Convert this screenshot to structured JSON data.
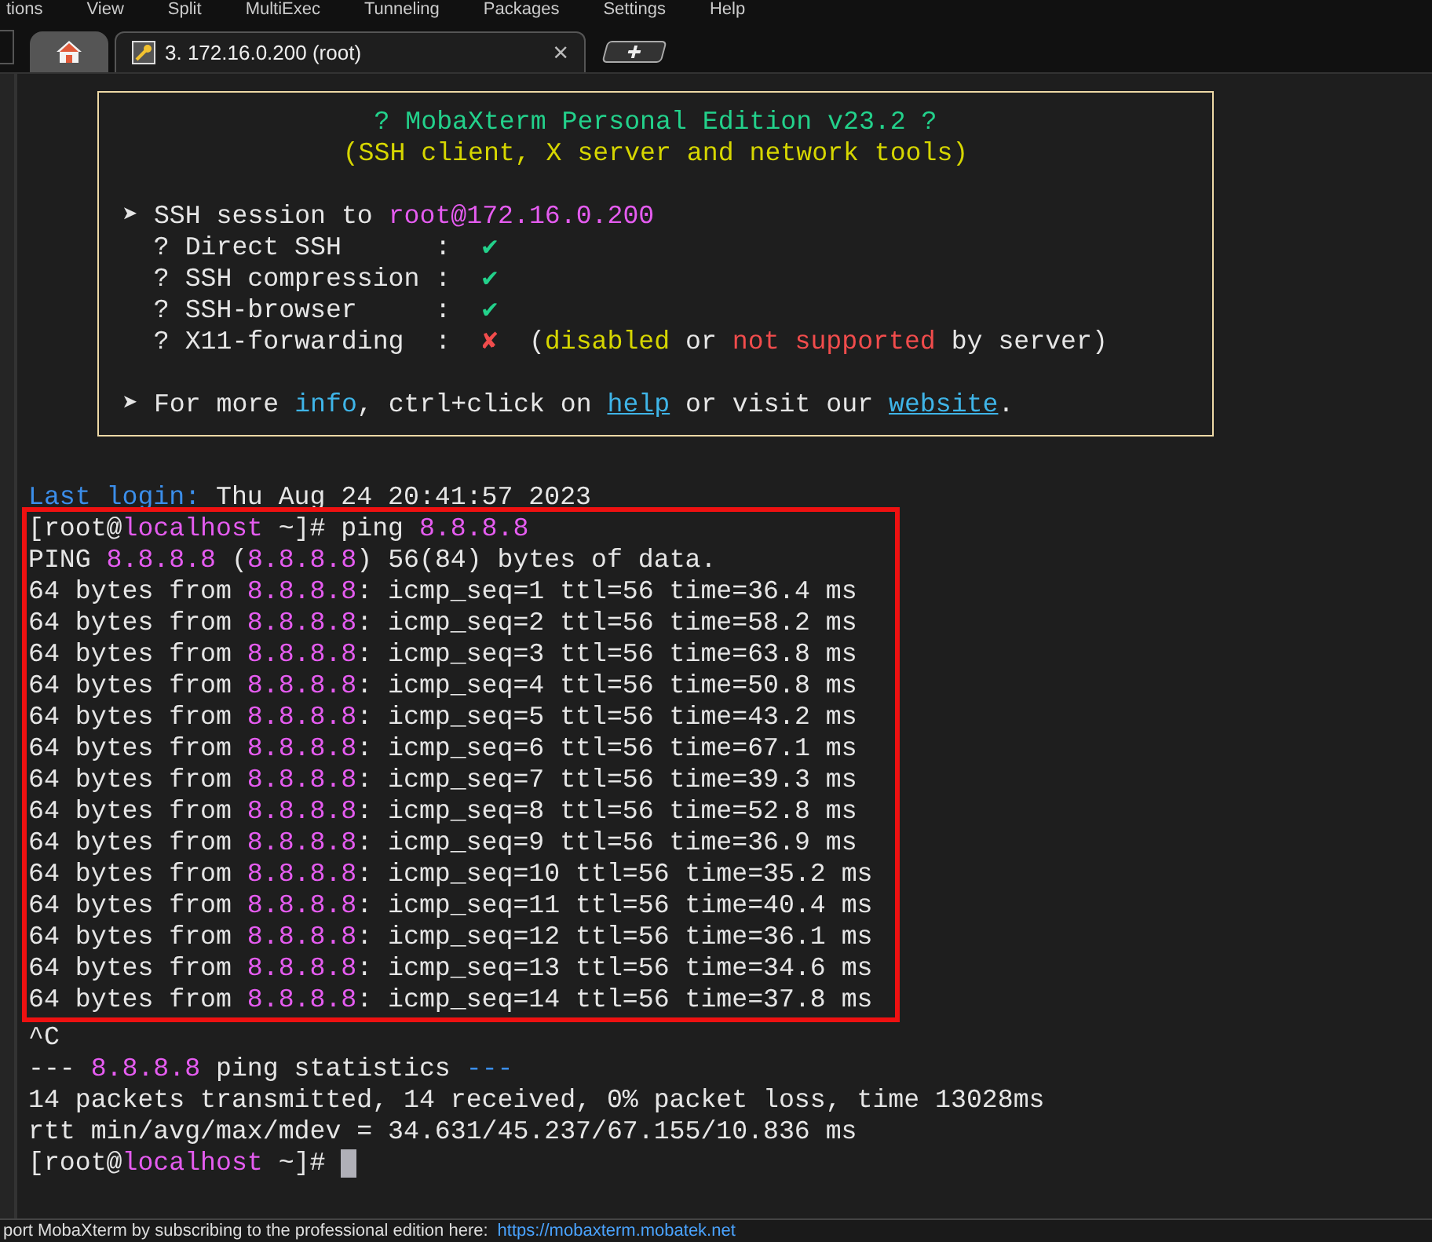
{
  "menu_bar": {
    "items": [
      "tions",
      "View",
      "Split",
      "MultiExec",
      "Tunneling",
      "Packages",
      "Settings",
      "Help"
    ]
  },
  "tabs": [
    {
      "kind": "home",
      "selected": false
    },
    {
      "kind": "session",
      "label": "3. 172.16.0.200 (root)",
      "selected": true,
      "close": "×"
    },
    {
      "kind": "new",
      "selected": false
    }
  ],
  "banner": {
    "header": [
      {
        "segments": [
          {
            "kind": "green",
            "text": "? MobaXterm Personal Edition v23.2 ?"
          }
        ]
      },
      {
        "segments": [
          {
            "kind": "yellow",
            "text": "(SSH client, X server and network tools)"
          }
        ]
      }
    ],
    "session": [
      {
        "segments": [
          {
            "kind": "plain",
            "text": "➤ SSH session to "
          },
          {
            "kind": "magenta",
            "text": "root@172.16.0.200"
          }
        ]
      },
      {
        "segments": [
          {
            "kind": "plain",
            "text": "  ? Direct SSH      :  "
          },
          {
            "kind": "green",
            "text": "✔"
          }
        ]
      },
      {
        "segments": [
          {
            "kind": "plain",
            "text": "  ? SSH compression :  "
          },
          {
            "kind": "green",
            "text": "✔"
          }
        ]
      },
      {
        "segments": [
          {
            "kind": "plain",
            "text": "  ? SSH-browser     :  "
          },
          {
            "kind": "green",
            "text": "✔"
          }
        ]
      },
      {
        "segments": [
          {
            "kind": "plain",
            "text": "  ? X11-forwarding  :  "
          },
          {
            "kind": "red",
            "text": "✘"
          },
          {
            "kind": "plain",
            "text": "  ("
          },
          {
            "kind": "yellow",
            "text": "disabled"
          },
          {
            "kind": "plain",
            "text": " or "
          },
          {
            "kind": "red",
            "text": "not supported"
          },
          {
            "kind": "plain",
            "text": " by server)"
          }
        ]
      }
    ],
    "footer": [
      {
        "segments": [
          {
            "kind": "plain",
            "text": "➤ For more "
          },
          {
            "kind": "cyan",
            "text": "info"
          },
          {
            "kind": "plain",
            "text": ", ctrl+click on "
          },
          {
            "kind": "link",
            "text": "help"
          },
          {
            "kind": "plain",
            "text": " or visit our "
          },
          {
            "kind": "link",
            "text": "website"
          },
          {
            "kind": "plain",
            "text": "."
          }
        ]
      }
    ]
  },
  "terminal": {
    "lines_before": [
      {
        "segments": [
          {
            "kind": "blue",
            "text": "Last login:"
          },
          {
            "kind": "plain",
            "text": " Thu Aug 24 20:41:57 2023"
          }
        ]
      }
    ],
    "highlighted_lines": [
      {
        "segments": [
          {
            "kind": "plain",
            "text": "[root@"
          },
          {
            "kind": "magenta",
            "text": "localhost"
          },
          {
            "kind": "plain",
            "text": " ~]# ping "
          },
          {
            "kind": "magenta",
            "text": "8.8.8.8"
          }
        ]
      },
      {
        "segments": [
          {
            "kind": "plain",
            "text": "PING "
          },
          {
            "kind": "magenta",
            "text": "8.8.8.8"
          },
          {
            "kind": "plain",
            "text": " ("
          },
          {
            "kind": "magenta",
            "text": "8.8.8.8"
          },
          {
            "kind": "plain",
            "text": ") 56(84) bytes of data."
          }
        ]
      },
      {
        "segments": [
          {
            "kind": "plain",
            "text": "64 bytes from "
          },
          {
            "kind": "magenta",
            "text": "8.8.8.8"
          },
          {
            "kind": "plain",
            "text": ": icmp_seq=1 ttl=56 time=36.4 ms"
          }
        ]
      },
      {
        "segments": [
          {
            "kind": "plain",
            "text": "64 bytes from "
          },
          {
            "kind": "magenta",
            "text": "8.8.8.8"
          },
          {
            "kind": "plain",
            "text": ": icmp_seq=2 ttl=56 time=58.2 ms"
          }
        ]
      },
      {
        "segments": [
          {
            "kind": "plain",
            "text": "64 bytes from "
          },
          {
            "kind": "magenta",
            "text": "8.8.8.8"
          },
          {
            "kind": "plain",
            "text": ": icmp_seq=3 ttl=56 time=63.8 ms"
          }
        ]
      },
      {
        "segments": [
          {
            "kind": "plain",
            "text": "64 bytes from "
          },
          {
            "kind": "magenta",
            "text": "8.8.8.8"
          },
          {
            "kind": "plain",
            "text": ": icmp_seq=4 ttl=56 time=50.8 ms"
          }
        ]
      },
      {
        "segments": [
          {
            "kind": "plain",
            "text": "64 bytes from "
          },
          {
            "kind": "magenta",
            "text": "8.8.8.8"
          },
          {
            "kind": "plain",
            "text": ": icmp_seq=5 ttl=56 time=43.2 ms"
          }
        ]
      },
      {
        "segments": [
          {
            "kind": "plain",
            "text": "64 bytes from "
          },
          {
            "kind": "magenta",
            "text": "8.8.8.8"
          },
          {
            "kind": "plain",
            "text": ": icmp_seq=6 ttl=56 time=67.1 ms"
          }
        ]
      },
      {
        "segments": [
          {
            "kind": "plain",
            "text": "64 bytes from "
          },
          {
            "kind": "magenta",
            "text": "8.8.8.8"
          },
          {
            "kind": "plain",
            "text": ": icmp_seq=7 ttl=56 time=39.3 ms"
          }
        ]
      },
      {
        "segments": [
          {
            "kind": "plain",
            "text": "64 bytes from "
          },
          {
            "kind": "magenta",
            "text": "8.8.8.8"
          },
          {
            "kind": "plain",
            "text": ": icmp_seq=8 ttl=56 time=52.8 ms"
          }
        ]
      },
      {
        "segments": [
          {
            "kind": "plain",
            "text": "64 bytes from "
          },
          {
            "kind": "magenta",
            "text": "8.8.8.8"
          },
          {
            "kind": "plain",
            "text": ": icmp_seq=9 ttl=56 time=36.9 ms"
          }
        ]
      },
      {
        "segments": [
          {
            "kind": "plain",
            "text": "64 bytes from "
          },
          {
            "kind": "magenta",
            "text": "8.8.8.8"
          },
          {
            "kind": "plain",
            "text": ": icmp_seq=10 ttl=56 time=35.2 ms"
          }
        ]
      },
      {
        "segments": [
          {
            "kind": "plain",
            "text": "64 bytes from "
          },
          {
            "kind": "magenta",
            "text": "8.8.8.8"
          },
          {
            "kind": "plain",
            "text": ": icmp_seq=11 ttl=56 time=40.4 ms"
          }
        ]
      },
      {
        "segments": [
          {
            "kind": "plain",
            "text": "64 bytes from "
          },
          {
            "kind": "magenta",
            "text": "8.8.8.8"
          },
          {
            "kind": "plain",
            "text": ": icmp_seq=12 ttl=56 time=36.1 ms"
          }
        ]
      },
      {
        "segments": [
          {
            "kind": "plain",
            "text": "64 bytes from "
          },
          {
            "kind": "magenta",
            "text": "8.8.8.8"
          },
          {
            "kind": "plain",
            "text": ": icmp_seq=13 ttl=56 time=34.6 ms"
          }
        ]
      },
      {
        "segments": [
          {
            "kind": "plain",
            "text": "64 bytes from "
          },
          {
            "kind": "magenta",
            "text": "8.8.8.8"
          },
          {
            "kind": "plain",
            "text": ": icmp_seq=14 ttl=56 time=37.8 ms"
          }
        ]
      }
    ],
    "lines_after": [
      {
        "segments": [
          {
            "kind": "plain",
            "text": "^C"
          }
        ]
      },
      {
        "segments": [
          {
            "kind": "plain",
            "text": "--- "
          },
          {
            "kind": "magenta",
            "text": "8.8.8.8"
          },
          {
            "kind": "plain",
            "text": " ping statistics "
          },
          {
            "kind": "blue",
            "text": "---"
          }
        ]
      },
      {
        "segments": [
          {
            "kind": "plain",
            "text": "14 packets transmitted, 14 received, 0% packet loss, time 13028ms"
          }
        ]
      },
      {
        "segments": [
          {
            "kind": "plain",
            "text": "rtt min/avg/max/mdev = 34.631/45.237/67.155/10.836 ms"
          }
        ]
      },
      {
        "segments": [
          {
            "kind": "plain",
            "text": "[root@"
          },
          {
            "kind": "magenta",
            "text": "localhost"
          },
          {
            "kind": "plain",
            "text": " ~]# "
          }
        ],
        "cursor": true
      }
    ]
  },
  "status_bar": {
    "text": "port MobaXterm by subscribing to the professional edition here:",
    "link": "https://mobaxterm.mobatek.net"
  }
}
